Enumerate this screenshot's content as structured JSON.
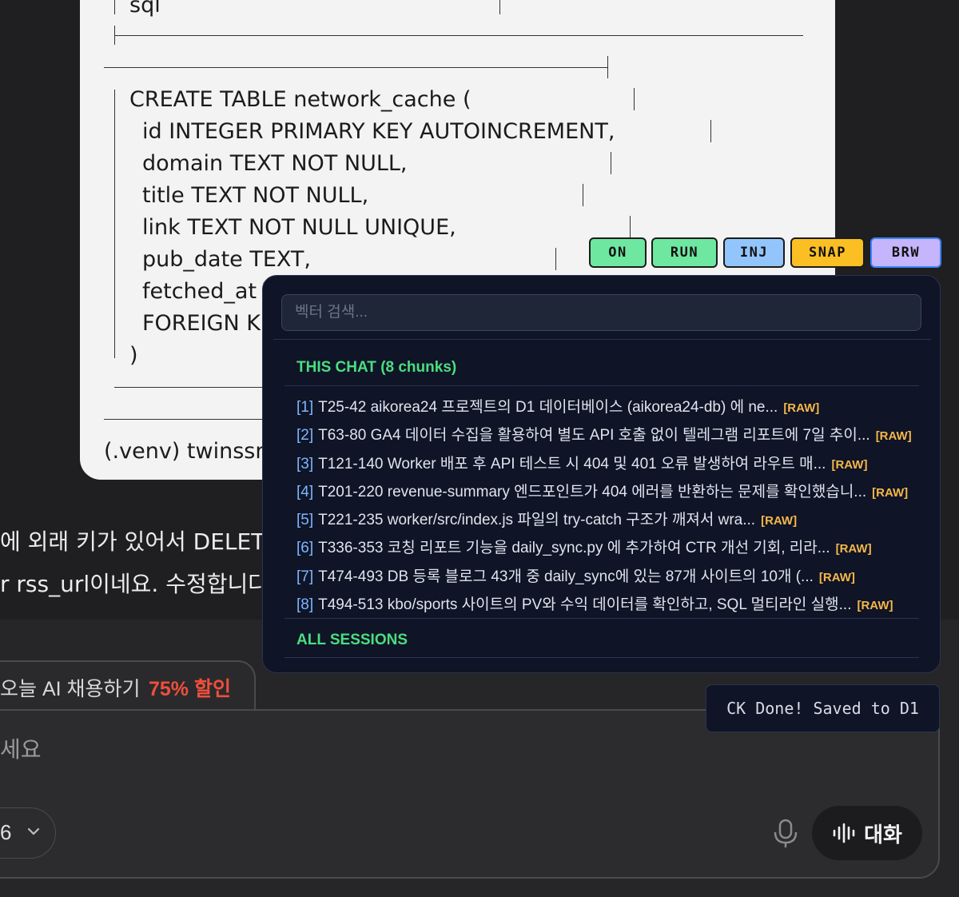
{
  "terminal": {
    "lines": {
      "sql": "sql",
      "create": "CREATE TABLE network_cache (",
      "id": "id INTEGER PRIMARY KEY AUTOINCREMENT,",
      "domain": "domain TEXT NOT NULL,",
      "title": "title TEXT NOT NULL,",
      "link": "link TEXT NOT NULL UNIQUE,",
      "pub_date": "pub_date TEXT,",
      "fetched": "fetched_at T",
      "foreign": "FOREIGN KE",
      "close": ")",
      "prompt": "(.venv) twinssn("
    }
  },
  "chat": {
    "line1": "에 외래 키가 있어서 DELETE",
    "line2": "r rss_url이네요. 수정합니다:"
  },
  "toggles": [
    {
      "label": "ON",
      "color": "#6ee7a0"
    },
    {
      "label": "RUN",
      "color": "#6ee7a0"
    },
    {
      "label": "INJ",
      "color": "#93c5fd"
    },
    {
      "label": "SNAP",
      "color": "#fbbf24"
    },
    {
      "label": "BRW",
      "color": "#c4b5fd"
    }
  ],
  "vector_panel": {
    "search_placeholder": "벡터 검색...",
    "this_chat_title": "THIS CHAT (8 chunks)",
    "raw_label": "[RAW]",
    "items": [
      {
        "num": "[1]",
        "text": "T25-42 aikorea24 프로젝트의 D1 데이터베이스 (aikorea24-db) 에 ne..."
      },
      {
        "num": "[2]",
        "text": "T63-80 GA4 데이터 수집을 활용하여 별도 API 호출 없이 텔레그램 리포트에 7일 추이..."
      },
      {
        "num": "[3]",
        "text": "T121-140 Worker 배포 후 API 테스트 시 404 및 401 오류 발생하여 라우트 매..."
      },
      {
        "num": "[4]",
        "text": "T201-220 revenue-summary 엔드포인트가 404 에러를 반환하는 문제를 확인했습니..."
      },
      {
        "num": "[5]",
        "text": "T221-235 worker/src/index.js 파일의 try-catch 구조가 깨져서 wra..."
      },
      {
        "num": "[6]",
        "text": "T336-353 코칭 리포트 기능을 daily_sync.py 에 추가하여 CTR 개선 기회, 리라..."
      },
      {
        "num": "[7]",
        "text": "T474-493 DB 등록 블로그 43개 중 daily_sync에 있는 87개 사이트의 10개 (..."
      },
      {
        "num": "[8]",
        "text": "T494-513 kbo/sports 사이트의 PV와 수익 데이터를 확인하고, SQL 멀티라인 실행..."
      }
    ],
    "all_sessions_title": "ALL SESSIONS"
  },
  "toast": {
    "text": "CK Done! Saved to D1"
  },
  "composer": {
    "promo_text": "오늘 AI 채용하기",
    "promo_sale": "75% 할인",
    "placeholder": "세요",
    "model_label": "6",
    "talk_label": "대화"
  }
}
